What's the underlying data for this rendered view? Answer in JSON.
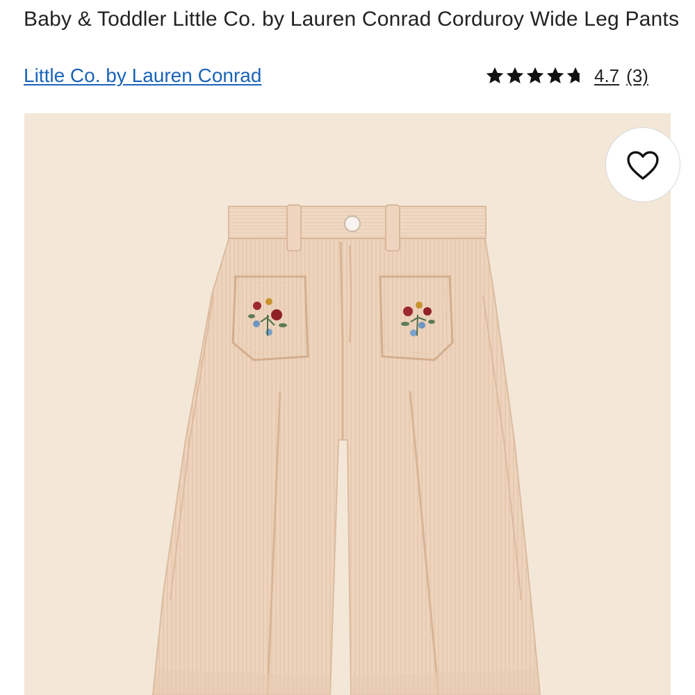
{
  "product": {
    "title": "Baby & Toddler Little Co. by Lauren Conrad Corduroy Wide Leg Pants",
    "brand_link": "Little Co. by Lauren Conrad",
    "rating": {
      "value": "4.7",
      "count": "(3)",
      "stars_filled": 4.7,
      "stars_total": 5
    },
    "image": {
      "background_color": "#f2e6d6",
      "garment_color": "#eed3bb"
    },
    "favorite_icon": "heart-outline-icon"
  }
}
